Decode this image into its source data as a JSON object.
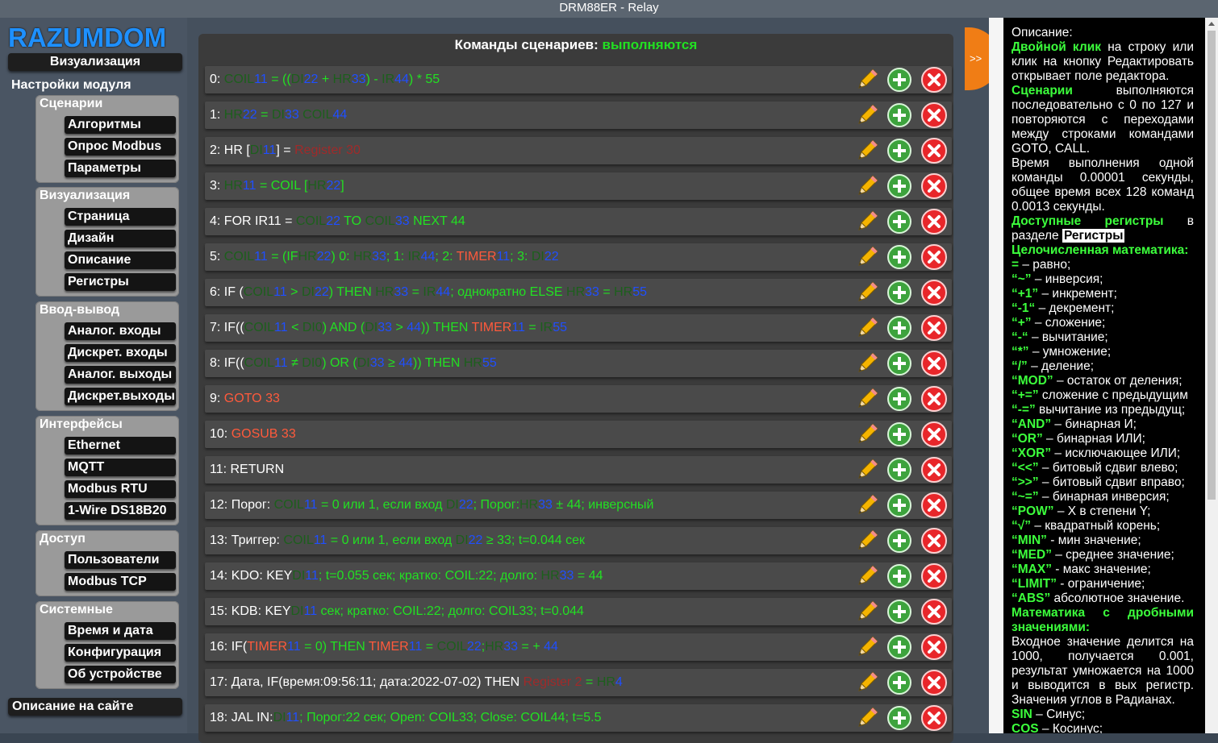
{
  "window": {
    "title": "DRM88ER - Relay"
  },
  "sidebar": {
    "logo": "RAZUMDOM",
    "top_button": "Визуализация",
    "settings_title": "Настройки модуля",
    "groups": [
      {
        "title": "Сценарии",
        "items": [
          "Алгоритмы",
          "Опрос Modbus",
          "Параметры"
        ]
      },
      {
        "title": "Визуализация",
        "items": [
          "Страница",
          "Дизайн",
          "Описание",
          "Регистры"
        ]
      },
      {
        "title": "Ввод-вывод",
        "items": [
          "Аналог. входы",
          "Дискрет. входы",
          "Аналог. выходы",
          "Дискрет.выходы"
        ]
      },
      {
        "title": "Интерфейсы",
        "items": [
          "Ethernet",
          "MQTT",
          "Modbus RTU",
          "1-Wire DS18B20"
        ]
      },
      {
        "title": "Доступ",
        "items": [
          "Пользователи",
          "Modbus TCP"
        ]
      },
      {
        "title": "Системные",
        "items": [
          "Время и дата",
          "Конфигурация",
          "Об устройстве"
        ]
      }
    ],
    "site_link": "Описание на сайте"
  },
  "main": {
    "header_label": "Команды сценариев:",
    "header_status": "выполняются",
    "toggle_label": ">>",
    "rows": [
      [
        [
          "w",
          "0: "
        ],
        [
          "dg",
          "COIL"
        ],
        [
          "b",
          "11"
        ],
        [
          "g",
          " = (("
        ],
        [
          "dg",
          "DI"
        ],
        [
          "b",
          "22"
        ],
        [
          "g",
          " + "
        ],
        [
          "dg",
          "HR"
        ],
        [
          "b",
          "33"
        ],
        [
          "g",
          ") - "
        ],
        [
          "dg",
          "IR"
        ],
        [
          "b",
          "44"
        ],
        [
          "g",
          ") * 55"
        ]
      ],
      [
        [
          "w",
          "1: "
        ],
        [
          "dg",
          "HR"
        ],
        [
          "b",
          "22"
        ],
        [
          "g",
          " = "
        ],
        [
          "dg",
          "DI"
        ],
        [
          "b",
          "33"
        ],
        [
          "dg",
          " COIL"
        ],
        [
          "b",
          "44"
        ]
      ],
      [
        [
          "w",
          "2: HR ["
        ],
        [
          "dg",
          "DI"
        ],
        [
          "b",
          "11"
        ],
        [
          "w",
          "] = "
        ],
        [
          "dr",
          "Register 30"
        ]
      ],
      [
        [
          "w",
          "3: "
        ],
        [
          "dg",
          "HR"
        ],
        [
          "b",
          "11"
        ],
        [
          "g",
          " = COIL ["
        ],
        [
          "dg",
          "HR"
        ],
        [
          "b",
          "22"
        ],
        [
          "g",
          "]"
        ]
      ],
      [
        [
          "w",
          "4: FOR IR11 = "
        ],
        [
          "dg",
          "COIL"
        ],
        [
          "b",
          "22"
        ],
        [
          "g",
          " TO "
        ],
        [
          "dg",
          "COIL"
        ],
        [
          "b",
          "33"
        ],
        [
          "g",
          " NEXT 44"
        ]
      ],
      [
        [
          "w",
          "5: "
        ],
        [
          "dg",
          "COIL"
        ],
        [
          "b",
          "11"
        ],
        [
          "g",
          " = (IF"
        ],
        [
          "dg",
          "HR"
        ],
        [
          "b",
          "22"
        ],
        [
          "g",
          ") 0: "
        ],
        [
          "dg",
          "HR"
        ],
        [
          "b",
          "33"
        ],
        [
          "g",
          "; 1: "
        ],
        [
          "dg",
          "IR"
        ],
        [
          "b",
          "44"
        ],
        [
          "g",
          "; 2: "
        ],
        [
          "r",
          "TIMER"
        ],
        [
          "b",
          "11"
        ],
        [
          "g",
          "; 3: "
        ],
        [
          "dg",
          "DI"
        ],
        [
          "b",
          "22"
        ]
      ],
      [
        [
          "w",
          "6: IF ("
        ],
        [
          "dg",
          "COIL"
        ],
        [
          "b",
          "11"
        ],
        [
          "g",
          " > "
        ],
        [
          "dg",
          "DI"
        ],
        [
          "b",
          "22"
        ],
        [
          "g",
          ") THEN "
        ],
        [
          "dg",
          "HR"
        ],
        [
          "b",
          "33"
        ],
        [
          "g",
          " = "
        ],
        [
          "dg",
          "IR"
        ],
        [
          "b",
          "44"
        ],
        [
          "g",
          "; однократно ELSE "
        ],
        [
          "dg",
          "HR"
        ],
        [
          "b",
          "33"
        ],
        [
          "g",
          " = "
        ],
        [
          "dg",
          "HR"
        ],
        [
          "b",
          "55"
        ]
      ],
      [
        [
          "w",
          "7: IF(("
        ],
        [
          "dg",
          "COIL"
        ],
        [
          "b",
          "11"
        ],
        [
          "g",
          " < "
        ],
        [
          "dg",
          "DI0"
        ],
        [
          "g",
          ") AND ("
        ],
        [
          "dg",
          "DI"
        ],
        [
          "b",
          "33"
        ],
        [
          "g",
          " > "
        ],
        [
          "b",
          "44"
        ],
        [
          "g",
          ")) THEN "
        ],
        [
          "r",
          "TIMER"
        ],
        [
          "b",
          "11"
        ],
        [
          "g",
          " = "
        ],
        [
          "dg",
          "IR"
        ],
        [
          "b",
          "55"
        ]
      ],
      [
        [
          "w",
          "8: IF(("
        ],
        [
          "dg",
          "COIL"
        ],
        [
          "b",
          "11"
        ],
        [
          "g",
          " ≠ "
        ],
        [
          "dg",
          "DI0"
        ],
        [
          "g",
          ") OR ("
        ],
        [
          "dg",
          "DI"
        ],
        [
          "b",
          "33"
        ],
        [
          "g",
          " ≥ "
        ],
        [
          "b",
          "44"
        ],
        [
          "g",
          ")) THEN "
        ],
        [
          "dg",
          "HR"
        ],
        [
          "b",
          "55"
        ]
      ],
      [
        [
          "w",
          "9: "
        ],
        [
          "r",
          "GOTO 33"
        ]
      ],
      [
        [
          "w",
          "10: "
        ],
        [
          "r",
          "GOSUB 33"
        ]
      ],
      [
        [
          "w",
          "11: RETURN"
        ]
      ],
      [
        [
          "w",
          "12: Порог: "
        ],
        [
          "dg",
          "COIL"
        ],
        [
          "b",
          "11"
        ],
        [
          "g",
          " = 0 или 1, если вход "
        ],
        [
          "dg",
          "DI"
        ],
        [
          "b",
          "22"
        ],
        [
          "g",
          "; Порог:"
        ],
        [
          "dg",
          "HR"
        ],
        [
          "b",
          "33"
        ],
        [
          "g",
          " ± 44; инверсный"
        ]
      ],
      [
        [
          "w",
          "13: Триггер: "
        ],
        [
          "dg",
          "COIL"
        ],
        [
          "b",
          "11"
        ],
        [
          "g",
          " = 0 или 1, если вход "
        ],
        [
          "dg",
          "DI"
        ],
        [
          "b",
          "22"
        ],
        [
          "g",
          " ≥ 33; t=0.044 сек"
        ]
      ],
      [
        [
          "w",
          "14: KDO: KEY"
        ],
        [
          "dg",
          "DI"
        ],
        [
          "b",
          "11"
        ],
        [
          "g",
          "; t=0.055 сек; кратко: COIL:22; долго: "
        ],
        [
          "dg",
          "HR"
        ],
        [
          "b",
          "33"
        ],
        [
          "g",
          " = 44"
        ]
      ],
      [
        [
          "w",
          "15: KDB: KEY"
        ],
        [
          "dg",
          "DI"
        ],
        [
          "b",
          "11"
        ],
        [
          "g",
          " сек; кратко: COIL:22; долго: COIL33; t=0.044"
        ]
      ],
      [
        [
          "w",
          "16: IF("
        ],
        [
          "r",
          "TIMER"
        ],
        [
          "b",
          "11"
        ],
        [
          "g",
          " = 0) THEN "
        ],
        [
          "r",
          "TIMER"
        ],
        [
          "b",
          "11"
        ],
        [
          "g",
          " = "
        ],
        [
          "dg",
          "COIL"
        ],
        [
          "b",
          "22"
        ],
        [
          "g",
          ";"
        ],
        [
          "dg",
          "HR"
        ],
        [
          "b",
          "33"
        ],
        [
          "g",
          " = + "
        ],
        [
          "b",
          "44"
        ]
      ],
      [
        [
          "w",
          "17: Дата, IF(время:09:56:11; дата:2022-07-02) THEN "
        ],
        [
          "dr",
          "Register 2"
        ],
        [
          "g",
          " = "
        ],
        [
          "dg",
          "HR"
        ],
        [
          "b",
          "4"
        ]
      ],
      [
        [
          "w",
          "18: JAL IN:"
        ],
        [
          "dg",
          "DI"
        ],
        [
          "b",
          "11"
        ],
        [
          "g",
          "; Порог:22 сек; Open: COIL33; Close: COIL44; t=5.5"
        ]
      ]
    ]
  },
  "description": {
    "lines": [
      [
        [
          "t",
          "Описание:"
        ]
      ],
      [
        [
          "gb",
          "Двойной клик"
        ],
        [
          "t",
          " на строку или клик на кнопку Редактировать открывает поле редактора."
        ]
      ],
      [
        [
          "gb",
          "Сценарии"
        ],
        [
          "t",
          " выполняются последовательно с 0 по 127 и повторяются с переходами между строками командами GOTO, CALL."
        ]
      ],
      [
        [
          "t",
          "Время выполнения одной команды 0.00001 секунды, общее время всех 128 команд 0.0013 секунды."
        ]
      ],
      [
        [
          "gb",
          "Доступные регистры"
        ],
        [
          "t",
          " в разделе "
        ],
        [
          "lbl",
          "Регистры"
        ]
      ],
      [
        [
          "gb",
          "Целочисленная математика:"
        ]
      ],
      [
        [
          "gb",
          "="
        ],
        [
          "t",
          " – равно;"
        ]
      ],
      [
        [
          "gb",
          "“~”"
        ],
        [
          "t",
          " – инверсия;"
        ]
      ],
      [
        [
          "gb",
          "“+1”"
        ],
        [
          "t",
          " – инкремент;"
        ]
      ],
      [
        [
          "gb",
          "“-1“"
        ],
        [
          "t",
          " – декремент;"
        ]
      ],
      [
        [
          "gb",
          "“+”"
        ],
        [
          "t",
          " – сложение;"
        ]
      ],
      [
        [
          "gb",
          "“-“"
        ],
        [
          "t",
          " – вычитание;"
        ]
      ],
      [
        [
          "gb",
          "“*”"
        ],
        [
          "t",
          " – умножение;"
        ]
      ],
      [
        [
          "gb",
          "“/”"
        ],
        [
          "t",
          " – деление;"
        ]
      ],
      [
        [
          "gb",
          "“MOD”"
        ],
        [
          "t",
          " – остаток от деления;"
        ]
      ],
      [
        [
          "gb",
          "“+=”"
        ],
        [
          "t",
          " сложение с предыдущим"
        ]
      ],
      [
        [
          "gb",
          "“-=”"
        ],
        [
          "t",
          " вычитание из предыдущ;"
        ]
      ],
      [
        [
          "gb",
          "“AND”"
        ],
        [
          "t",
          " – бинарная И;"
        ]
      ],
      [
        [
          "gb",
          "“OR”"
        ],
        [
          "t",
          " – бинарная ИЛИ;"
        ]
      ],
      [
        [
          "gb",
          "“XOR”"
        ],
        [
          "t",
          " – исключающее ИЛИ;"
        ]
      ],
      [
        [
          "gb",
          "“<<”"
        ],
        [
          "t",
          " – битовый сдвиг влево;"
        ]
      ],
      [
        [
          "gb",
          "“>>”"
        ],
        [
          "t",
          " – битовый сдвиг вправо;"
        ]
      ],
      [
        [
          "gb",
          "“~=”"
        ],
        [
          "t",
          " – бинарная инверсия;"
        ]
      ],
      [
        [
          "gb",
          "“POW”"
        ],
        [
          "t",
          " – X в степени Y;"
        ]
      ],
      [
        [
          "gb",
          "“√”"
        ],
        [
          "t",
          " – квадратный корень;"
        ]
      ],
      [
        [
          "gb",
          "“MIN”"
        ],
        [
          "t",
          " - мин значение;"
        ]
      ],
      [
        [
          "gb",
          "“MED”"
        ],
        [
          "t",
          " – среднее значение;"
        ]
      ],
      [
        [
          "gb",
          "“MAX”"
        ],
        [
          "t",
          " - макс значение;"
        ]
      ],
      [
        [
          "gb",
          "“LIMIT”"
        ],
        [
          "t",
          " - ограничение;"
        ]
      ],
      [
        [
          "gb",
          "“ABS”"
        ],
        [
          "t",
          " абсолютное значение."
        ]
      ],
      [
        [
          "gb",
          "Математика с дробными значениями:"
        ]
      ],
      [
        [
          "t",
          "Входное значение делится на 1000, получается 0.001, результат умножается на 1000 и выводится в вых регистр. Значения углов в Радианах."
        ]
      ],
      [
        [
          "gb",
          "SIN"
        ],
        [
          "t",
          " – Синус;"
        ]
      ],
      [
        [
          "gb",
          "COS"
        ],
        [
          "t",
          " – Косинус;"
        ]
      ]
    ]
  }
}
